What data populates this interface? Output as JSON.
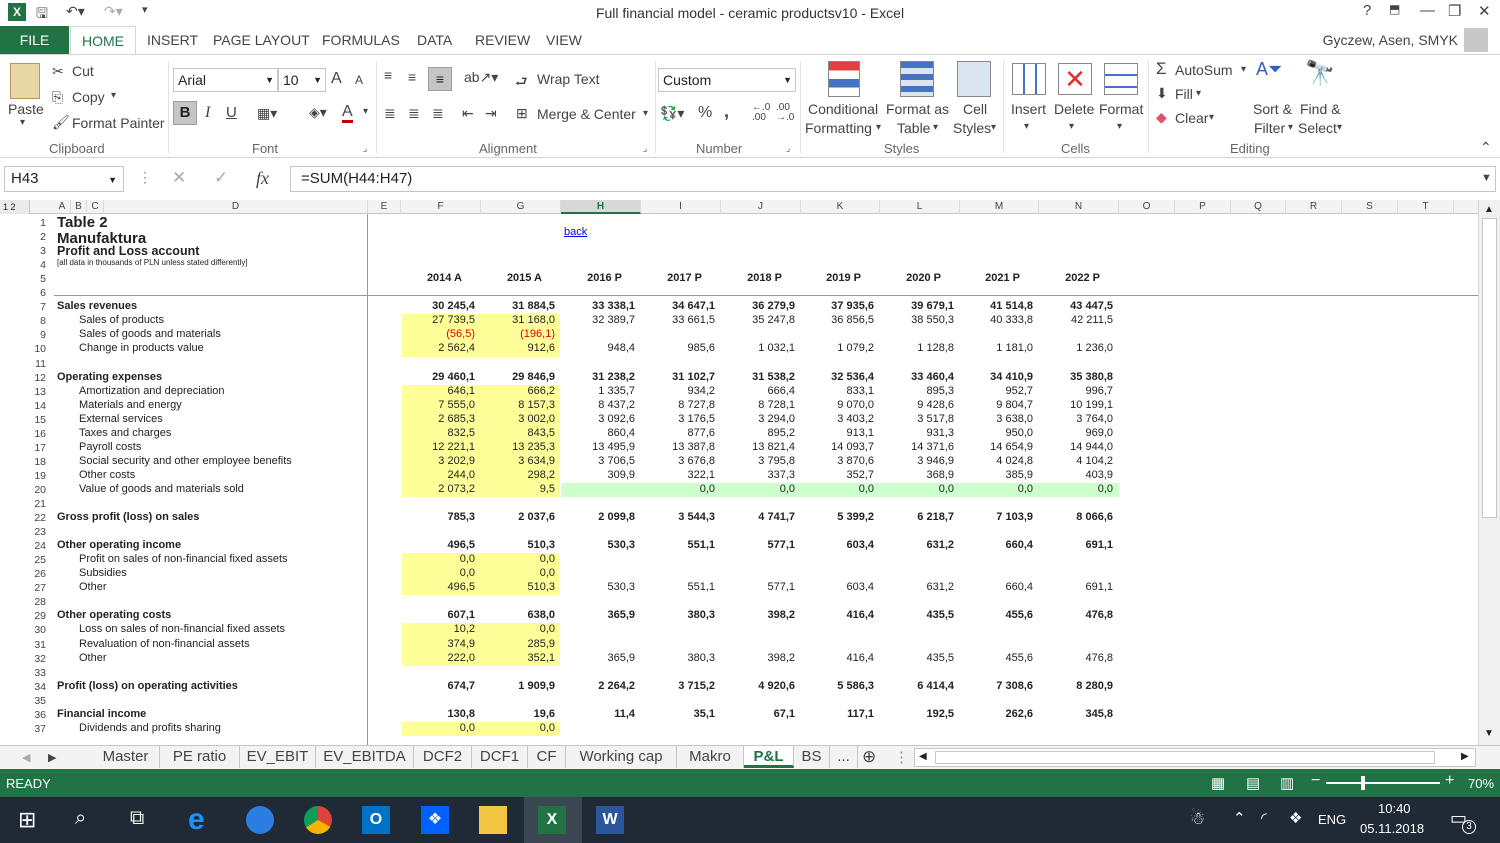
{
  "window": {
    "title": "Full financial model - ceramic productsv10 - Excel",
    "user": "Gyczew, Asen, SMYK",
    "help": "?",
    "minimize": "—",
    "restore": "❐",
    "close": "✕"
  },
  "ribbon_tabs": [
    "FILE",
    "HOME",
    "INSERT",
    "PAGE LAYOUT",
    "FORMULAS",
    "DATA",
    "REVIEW",
    "VIEW"
  ],
  "clipboard": {
    "paste": "Paste",
    "cut": "Cut",
    "copy": "Copy",
    "format_painter": "Format Painter",
    "group": "Clipboard"
  },
  "font": {
    "name": "Arial",
    "size": "10",
    "bold": "B",
    "italic": "I",
    "underline": "U",
    "grow": "A",
    "shrink": "A",
    "color_letter": "A",
    "group": "Font"
  },
  "alignment": {
    "wrap": "Wrap Text",
    "merge": "Merge & Center",
    "group": "Alignment"
  },
  "number": {
    "format": "Custom",
    "percent": "%",
    "comma": ",",
    "inc": ".00",
    "dec": ".00",
    "group": "Number"
  },
  "styles": {
    "conditional": "Conditional",
    "conditional2": "Formatting",
    "format_as": "Format as",
    "table": "Table",
    "cell": "Cell",
    "styles": "Styles",
    "group": "Styles"
  },
  "cells": {
    "insert": "Insert",
    "delete": "Delete",
    "format": "Format",
    "group": "Cells"
  },
  "editing": {
    "autosum": "AutoSum",
    "fill": "Fill",
    "clear": "Clear",
    "sort": "Sort &",
    "filter": "Filter",
    "find": "Find &",
    "select": "Select",
    "group": "Editing"
  },
  "formula_bar": {
    "name_box": "H43",
    "fx": "fx",
    "formula": "=SUM(H44:H47)"
  },
  "columns": [
    "A",
    "B",
    "C",
    "D",
    "E",
    "F",
    "G",
    "H",
    "I",
    "J",
    "K",
    "L",
    "M",
    "N",
    "O",
    "P",
    "Q",
    "R",
    "S",
    "T"
  ],
  "header_rows": {
    "r1": "Table 2",
    "r2": "Manufaktura",
    "r3": "Profit and Loss account",
    "r4": "[all data in thousands of PLN unless stated differently]",
    "back": "back"
  },
  "years": [
    "2014 A",
    "2015 A",
    "2016 P",
    "2017 P",
    "2018 P",
    "2019 P",
    "2020 P",
    "2021 P",
    "2022 P"
  ],
  "rows": [
    {
      "n": "7",
      "label": "Sales revenues",
      "bold": true,
      "indent": false,
      "v": [
        "30 245,4",
        "31 884,5",
        "33 338,1",
        "34 647,1",
        "36 279,9",
        "37 935,6",
        "39 679,1",
        "41 514,8",
        "43 447,5"
      ]
    },
    {
      "n": "8",
      "label": "Sales of products",
      "indent": true,
      "v": [
        "27 739,5",
        "31 168,0",
        "32 389,7",
        "33 661,5",
        "35 247,8",
        "36 856,5",
        "38 550,3",
        "40 333,8",
        "42 211,5"
      ]
    },
    {
      "n": "9",
      "label": "Sales of goods and materials",
      "indent": true,
      "red": true,
      "v": [
        "(56,5)",
        "(196,1)",
        "",
        "",
        "",
        "",
        "",
        "",
        ""
      ]
    },
    {
      "n": "10",
      "label": "Change in products value",
      "indent": true,
      "v": [
        "2 562,4",
        "912,6",
        "948,4",
        "985,6",
        "1 032,1",
        "1 079,2",
        "1 128,8",
        "1 181,0",
        "1 236,0"
      ]
    },
    {
      "n": "12",
      "label": "Operating expenses",
      "bold": true,
      "v": [
        "29 460,1",
        "29 846,9",
        "31 238,2",
        "31 102,7",
        "31 538,2",
        "32 536,4",
        "33 460,4",
        "34 410,9",
        "35 380,8"
      ]
    },
    {
      "n": "13",
      "label": "Amortization and depreciation",
      "indent": true,
      "v": [
        "646,1",
        "666,2",
        "1 335,7",
        "934,2",
        "666,4",
        "833,1",
        "895,3",
        "952,7",
        "996,7"
      ]
    },
    {
      "n": "14",
      "label": "Materials and energy",
      "indent": true,
      "v": [
        "7 555,0",
        "8 157,3",
        "8 437,2",
        "8 727,8",
        "8 728,1",
        "9 070,0",
        "9 428,6",
        "9 804,7",
        "10 199,1"
      ]
    },
    {
      "n": "15",
      "label": "External services",
      "indent": true,
      "v": [
        "2 685,3",
        "3 002,0",
        "3 092,6",
        "3 176,5",
        "3 294,0",
        "3 403,2",
        "3 517,8",
        "3 638,0",
        "3 764,0"
      ]
    },
    {
      "n": "16",
      "label": "Taxes and charges",
      "indent": true,
      "v": [
        "832,5",
        "843,5",
        "860,4",
        "877,6",
        "895,2",
        "913,1",
        "931,3",
        "950,0",
        "969,0"
      ]
    },
    {
      "n": "17",
      "label": "Payroll costs",
      "indent": true,
      "v": [
        "12 221,1",
        "13 235,3",
        "13 495,9",
        "13 387,8",
        "13 821,4",
        "14 093,7",
        "14 371,6",
        "14 654,9",
        "14 944,0"
      ]
    },
    {
      "n": "18",
      "label": "Social security and other employee benefits",
      "indent": true,
      "v": [
        "3 202,9",
        "3 634,9",
        "3 706,5",
        "3 676,8",
        "3 795,8",
        "3 870,6",
        "3 946,9",
        "4 024,8",
        "4 104,2"
      ]
    },
    {
      "n": "19",
      "label": "Other costs",
      "indent": true,
      "v": [
        "244,0",
        "298,2",
        "309,9",
        "322,1",
        "337,3",
        "352,7",
        "368,9",
        "385,9",
        "403,9"
      ]
    },
    {
      "n": "20",
      "label": "Value of goods and materials sold",
      "indent": true,
      "v": [
        "2 073,2",
        "9,5",
        "",
        "0,0",
        "0,0",
        "0,0",
        "0,0",
        "0,0",
        "0,0"
      ]
    },
    {
      "n": "22",
      "label": "Gross profit (loss) on sales",
      "bold": true,
      "v": [
        "785,3",
        "2 037,6",
        "2 099,8",
        "3 544,3",
        "4 741,7",
        "5 399,2",
        "6 218,7",
        "7 103,9",
        "8 066,6"
      ]
    },
    {
      "n": "24",
      "label": "Other operating income",
      "bold": true,
      "v": [
        "496,5",
        "510,3",
        "530,3",
        "551,1",
        "577,1",
        "603,4",
        "631,2",
        "660,4",
        "691,1"
      ]
    },
    {
      "n": "25",
      "label": "Profit on sales of non-financial fixed assets",
      "indent": true,
      "v": [
        "0,0",
        "0,0",
        "",
        "",
        "",
        "",
        "",
        "",
        ""
      ]
    },
    {
      "n": "26",
      "label": "Subsidies",
      "indent": true,
      "v": [
        "0,0",
        "0,0",
        "",
        "",
        "",
        "",
        "",
        "",
        ""
      ]
    },
    {
      "n": "27",
      "label": "Other",
      "indent": true,
      "v": [
        "496,5",
        "510,3",
        "530,3",
        "551,1",
        "577,1",
        "603,4",
        "631,2",
        "660,4",
        "691,1"
      ]
    },
    {
      "n": "29",
      "label": "Other operating costs",
      "bold": true,
      "v": [
        "607,1",
        "638,0",
        "365,9",
        "380,3",
        "398,2",
        "416,4",
        "435,5",
        "455,6",
        "476,8"
      ]
    },
    {
      "n": "30",
      "label": "Loss on sales of non-financial fixed assets",
      "indent": true,
      "v": [
        "10,2",
        "0,0",
        "",
        "",
        "",
        "",
        "",
        "",
        ""
      ]
    },
    {
      "n": "31",
      "label": "Revaluation of non-financial assets",
      "indent": true,
      "v": [
        "374,9",
        "285,9",
        "",
        "",
        "",
        "",
        "",
        "",
        ""
      ]
    },
    {
      "n": "32",
      "label": "Other",
      "indent": true,
      "v": [
        "222,0",
        "352,1",
        "365,9",
        "380,3",
        "398,2",
        "416,4",
        "435,5",
        "455,6",
        "476,8"
      ]
    },
    {
      "n": "34",
      "label": "Profit (loss) on operating activities",
      "bold": true,
      "v": [
        "674,7",
        "1 909,9",
        "2 264,2",
        "3 715,2",
        "4 920,6",
        "5 586,3",
        "6 414,4",
        "7 308,6",
        "8 280,9"
      ]
    },
    {
      "n": "36",
      "label": "Financial income",
      "bold": true,
      "v": [
        "130,8",
        "19,6",
        "11,4",
        "35,1",
        "67,1",
        "117,1",
        "192,5",
        "262,6",
        "345,8"
      ]
    },
    {
      "n": "37",
      "label": "Dividends and profits sharing",
      "indent": true,
      "v": [
        "0,0",
        "0,0",
        "",
        "",
        "",
        "",
        "",
        "",
        ""
      ]
    }
  ],
  "empty_rows": [
    "1",
    "2",
    "3",
    "4",
    "5",
    "6",
    "11",
    "21",
    "23",
    "28",
    "33",
    "35"
  ],
  "sheet_tabs": [
    "Master",
    "PE ratio",
    "EV_EBIT",
    "EV_EBITDA",
    "DCF2",
    "DCF1",
    "CF",
    "Working cap",
    "Makro",
    "P&L",
    "BS",
    "..."
  ],
  "active_sheet": "P&L",
  "status": {
    "ready": "READY",
    "zoom": "70%"
  },
  "taskbar": {
    "lang": "ENG",
    "time": "10:40",
    "date": "05.11.2018",
    "notif": "3"
  }
}
